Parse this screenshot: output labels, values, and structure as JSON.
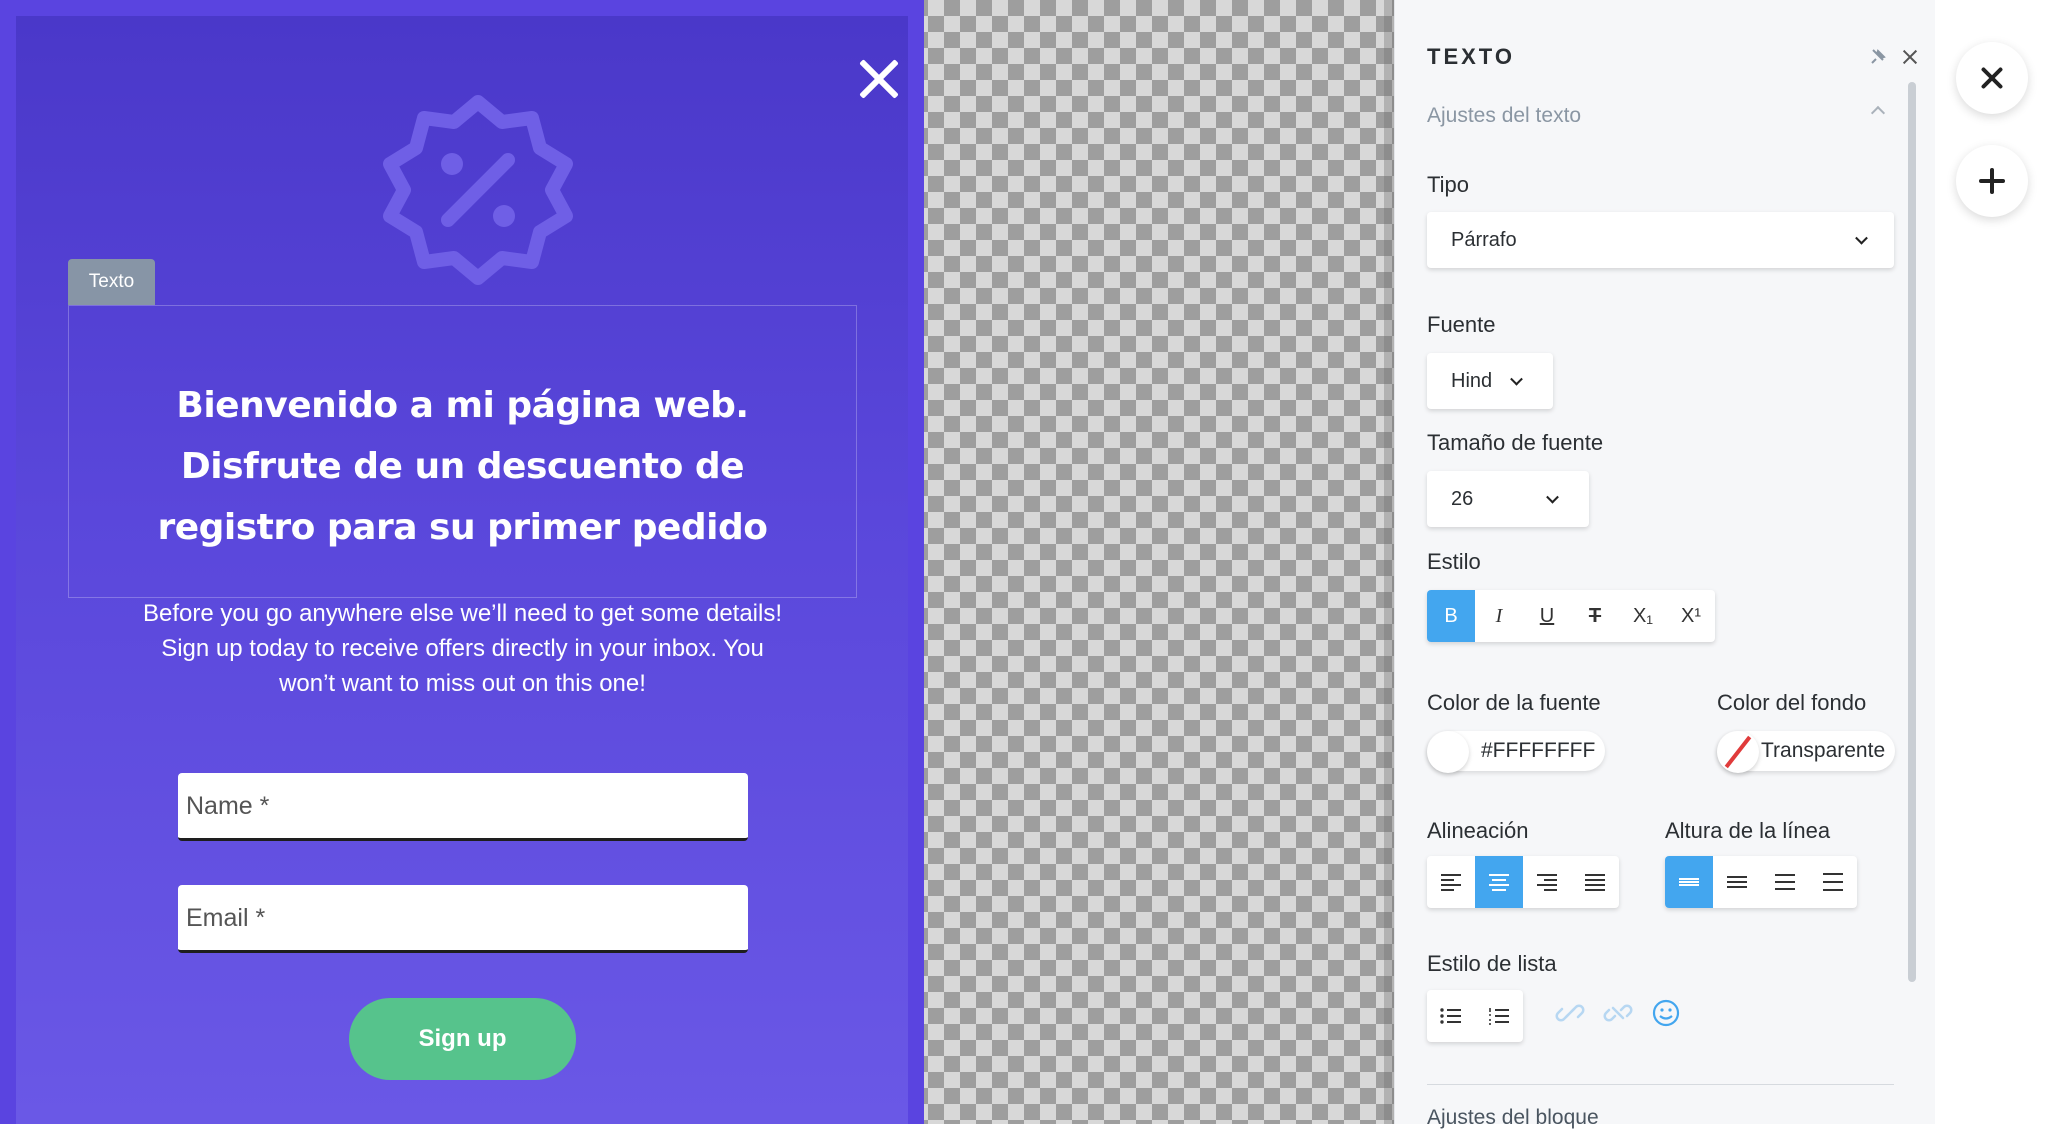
{
  "popup": {
    "text_tag": "Texto",
    "headline_line1": "Bienvenido a mi página web.",
    "headline_line2": "Disfrute de un descuento de",
    "headline_line3": "registro para su primer pedido",
    "sub_line1": "Before you go anywhere else we’ll need to get some details!",
    "sub_line2": "Sign up today to receive offers directly in your inbox. You",
    "sub_line3": "won’t want to miss out on this one!",
    "name_placeholder": "Name *",
    "email_placeholder": "Email *",
    "signup_label": "Sign up",
    "colors": {
      "background": "#5a44e0",
      "button": "#56c38c"
    }
  },
  "panel": {
    "title": "TEXTO",
    "section_text_settings": "Ajustes del texto",
    "tipo_label": "Tipo",
    "tipo_value": "Párrafo",
    "fuente_label": "Fuente",
    "fuente_value": "Hind",
    "size_label": "Tamaño de fuente",
    "size_value": "26",
    "estilo_label": "Estilo",
    "style_buttons": [
      "B",
      "I",
      "U",
      "T",
      "X₁",
      "X¹"
    ],
    "font_color_label": "Color de la fuente",
    "font_color_value": "#FFFFFFFF",
    "bg_color_label": "Color del fondo",
    "bg_color_value": "Transparente",
    "alignment_label": "Alineación",
    "line_height_label": "Altura de la línea",
    "list_style_label": "Estilo de lista",
    "section_block_settings": "Ajustes del bloque",
    "accent_color": "#43a6ef"
  }
}
